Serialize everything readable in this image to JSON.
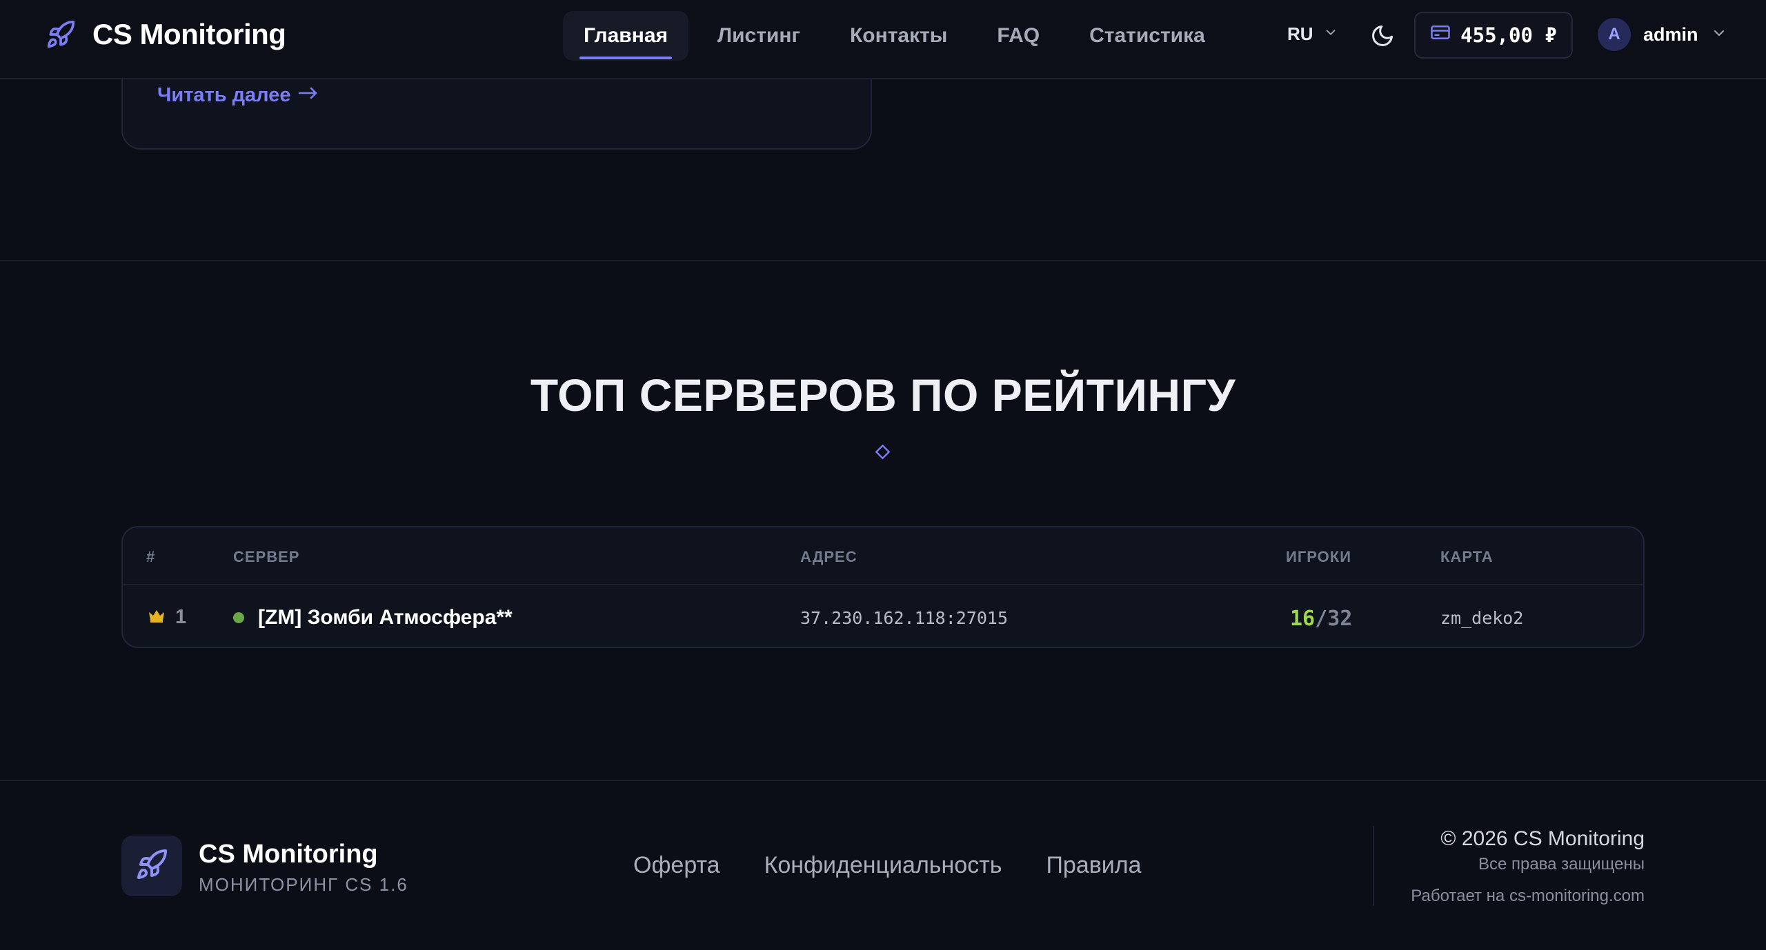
{
  "header": {
    "brand": "CS Monitoring",
    "nav": [
      "Главная",
      "Листинг",
      "Контакты",
      "FAQ",
      "Статистика"
    ],
    "active_nav": "Главная",
    "lang": "RU",
    "balance": "455,00 ₽",
    "avatar_letter": "A",
    "username": "admin"
  },
  "card": {
    "read_more": "Читать далее"
  },
  "top": {
    "title": "ТОП СЕРВЕРОВ ПО РЕЙТИНГУ",
    "columns": {
      "rank": "#",
      "server": "СЕРВЕР",
      "address": "АДРЕС",
      "players": "ИГРОКИ",
      "map": "КАРТА"
    },
    "rows": [
      {
        "rank": "1",
        "name": "[ZM] Зомби Атмосфера**",
        "address": "37.230.162.118:27015",
        "players_current": "16",
        "players_max": "32",
        "map": "zm_deko2"
      }
    ]
  },
  "footer": {
    "brand": "CS Monitoring",
    "subtitle": "МОНИТОРИНГ CS 1.6",
    "links": [
      "Оферта",
      "Конфиденциальность",
      "Правила"
    ],
    "copyright": "© 2026 CS Monitoring",
    "rights": "Все права защищены",
    "powered": "Работает на cs-monitoring.com"
  },
  "colors": {
    "accent": "#7b7ef5",
    "online": "#6aa847",
    "players_current": "#9fd84d",
    "crown": "#e6b422"
  },
  "icons": {
    "logo": "rocket-icon",
    "lang_dropdown": "chevron-down-icon",
    "theme": "moon-icon",
    "balance": "credit-card-icon",
    "user_dropdown": "chevron-down-icon",
    "read_more": "arrow-right-icon",
    "rank_first": "crown-icon",
    "status": "online-dot-icon"
  }
}
